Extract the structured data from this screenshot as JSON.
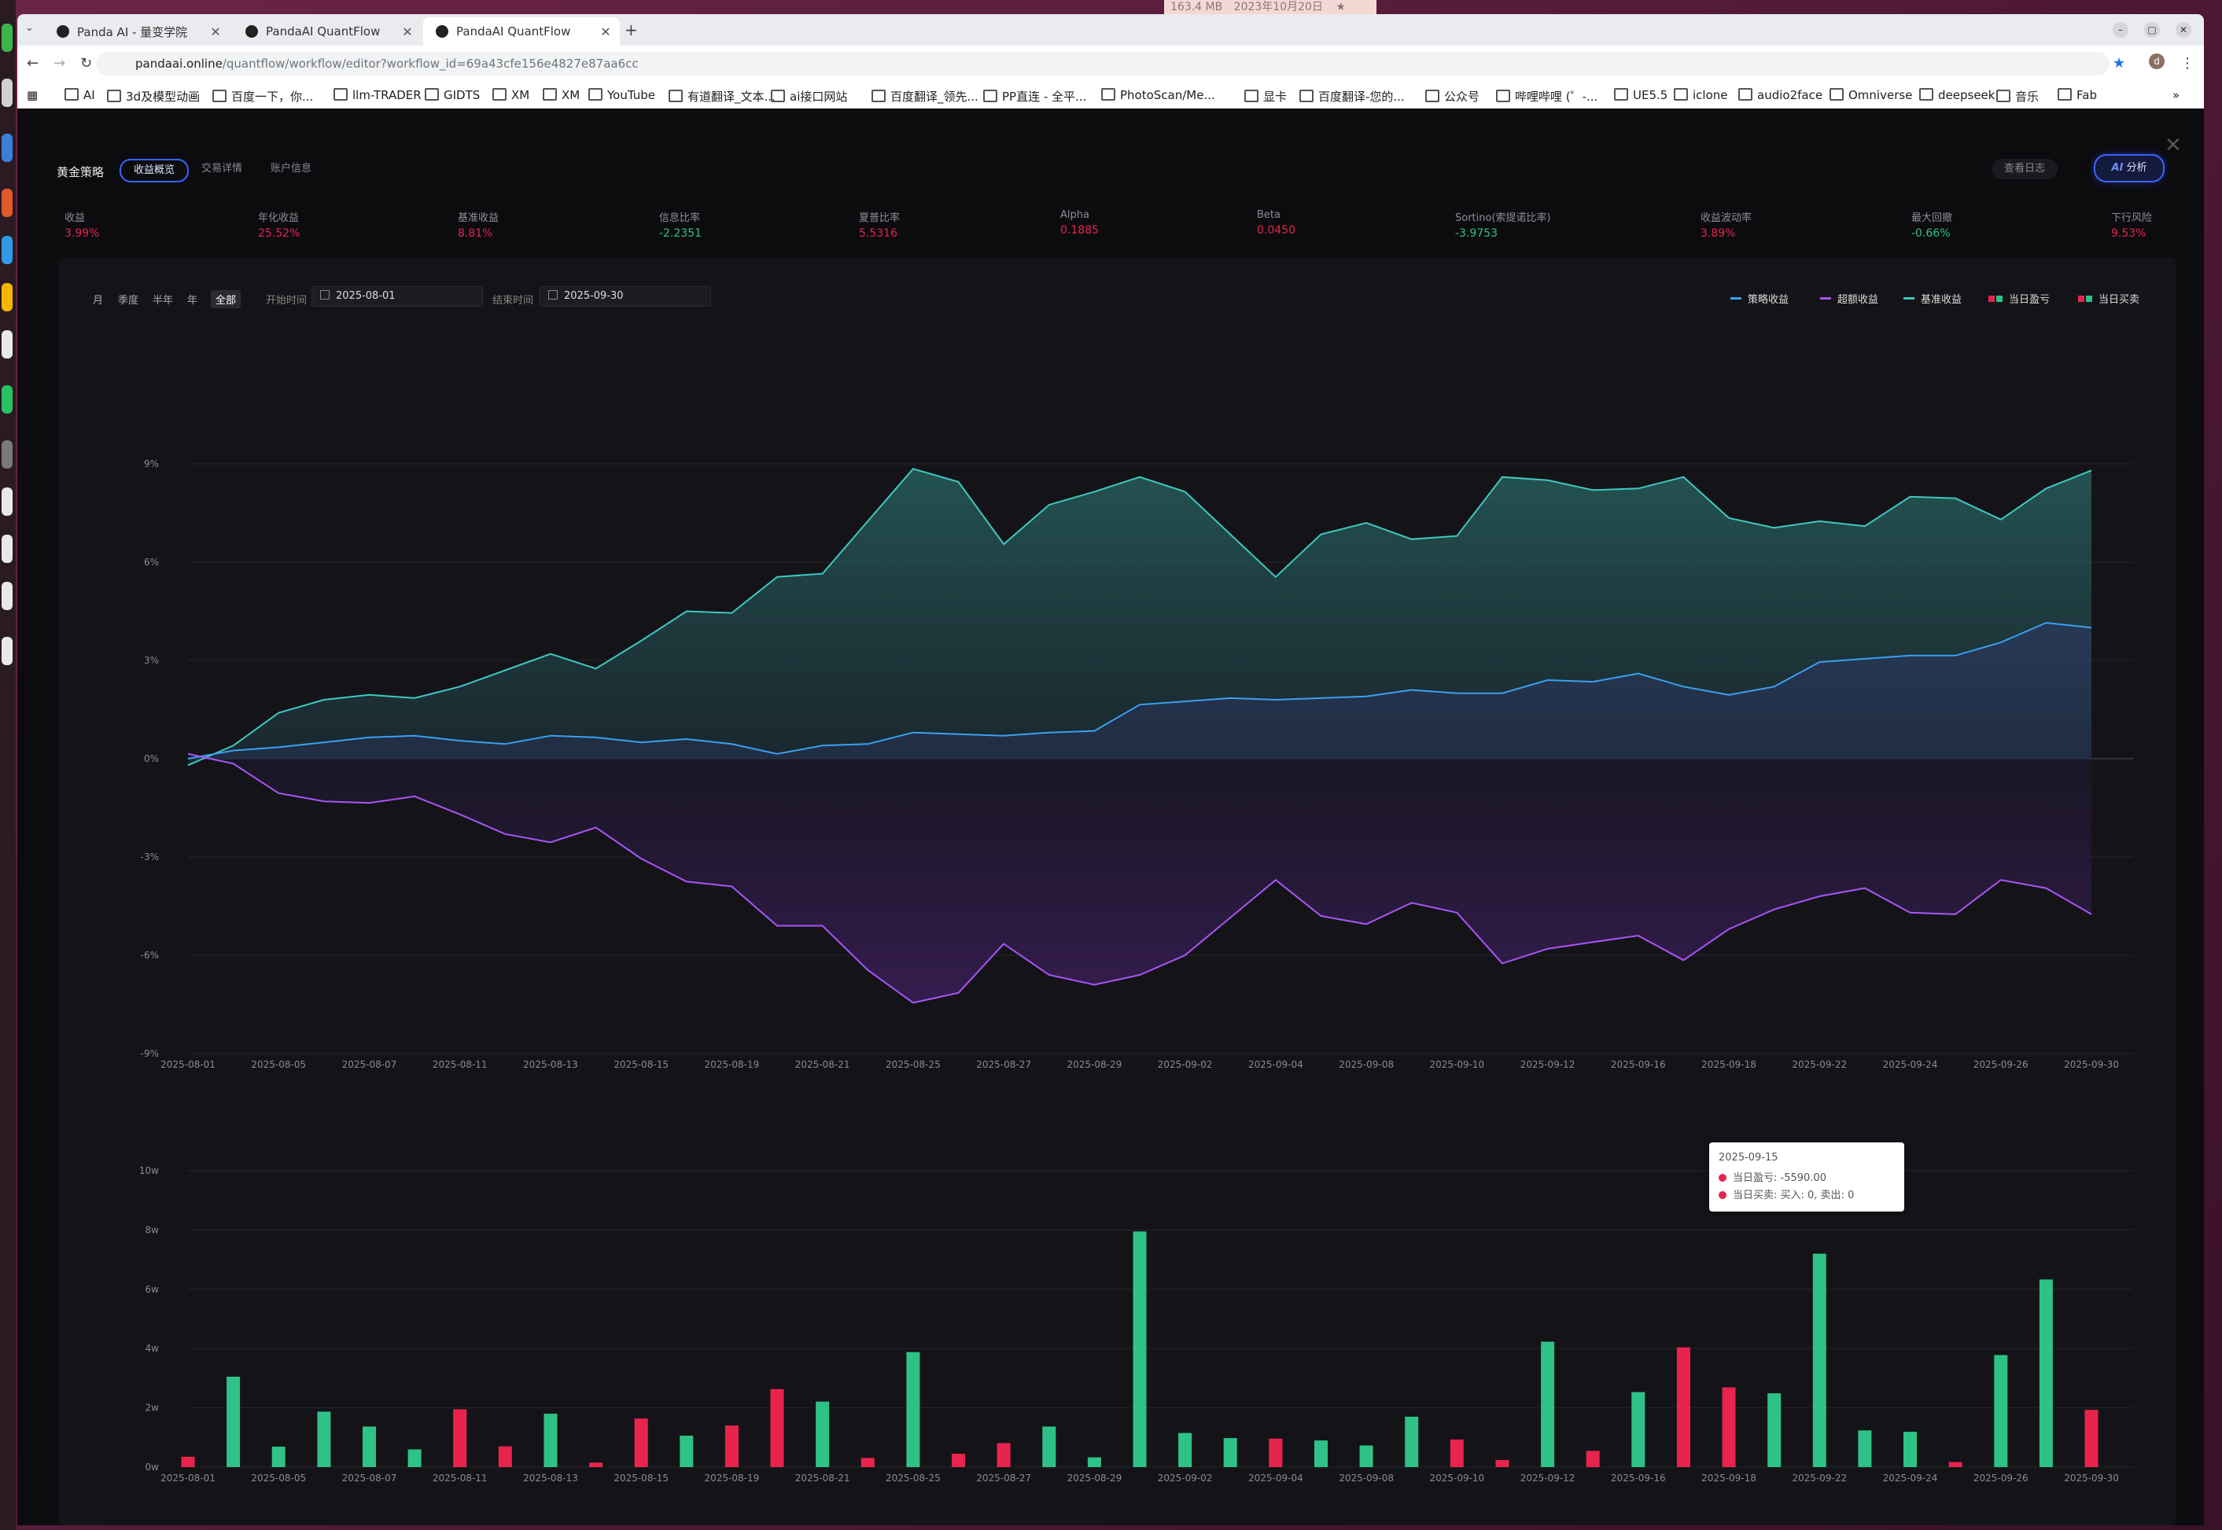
{
  "system": {
    "memory": "163.4 MB",
    "date": "2023年10月20日"
  },
  "tabs": [
    {
      "title": "Panda AI - 量变学院",
      "active": false
    },
    {
      "title": "PandaAI QuantFlow",
      "active": false
    },
    {
      "title": "PandaAI QuantFlow",
      "active": true
    }
  ],
  "address": {
    "domain": "pandaai.online",
    "path": "/quantflow/workflow/editor?workflow_id=69a43cfe156e4827e87aa6cc"
  },
  "bookmarks": [
    "AI",
    "3d及模型动画",
    "百度一下，你...",
    "llm-TRADER",
    "GIDTS",
    "XM",
    "XM",
    "YouTube",
    "有道翻译_文本...",
    "ai接口网站",
    "百度翻译_领先...",
    "PP直连 - 全平...",
    "PhotoScan/Me...",
    "显卡",
    "百度翻译-您的...",
    "公众号",
    "哔哩哔哩 (゜-...",
    "UE5.5",
    "iclone",
    "audio2face",
    "Omniverse",
    "deepseek",
    "音乐",
    "Fab"
  ],
  "header": {
    "title": "黄金策略",
    "subtabs": [
      "收益概览",
      "交易详情",
      "账户信息"
    ],
    "log_button": "查看日志",
    "ai_button": "分析",
    "ai_prefix": "AI"
  },
  "metrics": [
    {
      "label": "收益",
      "value": "3.99%",
      "color": "red"
    },
    {
      "label": "年化收益",
      "value": "25.52%",
      "color": "red"
    },
    {
      "label": "基准收益",
      "value": "8.81%",
      "color": "red"
    },
    {
      "label": "信息比率",
      "value": "-2.2351",
      "color": "green"
    },
    {
      "label": "夏普比率",
      "value": "5.5316",
      "color": "red"
    },
    {
      "label": "Alpha",
      "value": "0.1885",
      "color": "red"
    },
    {
      "label": "Beta",
      "value": "0.0450",
      "color": "red"
    },
    {
      "label": "Sortino(索提诺比率)",
      "value": "-3.9753",
      "color": "green"
    },
    {
      "label": "收益波动率",
      "value": "3.89%",
      "color": "red"
    },
    {
      "label": "最大回撤",
      "value": "-0.66%",
      "color": "green"
    },
    {
      "label": "下行风险",
      "value": "9.53%",
      "color": "red"
    }
  ],
  "controls": {
    "ranges": [
      "月",
      "季度",
      "半年",
      "年",
      "全部"
    ],
    "active_range": "全部",
    "start_label": "开始时间",
    "start_value": "2025-08-01",
    "end_label": "结束时间",
    "end_value": "2025-09-30"
  },
  "legend": [
    {
      "name": "策略收益",
      "color": "#3aa0f0",
      "kind": "line"
    },
    {
      "name": "超额收益",
      "color": "#a855f7",
      "kind": "line"
    },
    {
      "name": "基准收益",
      "color": "#3ec9c0",
      "kind": "line"
    },
    {
      "name": "当日盈亏",
      "color": "#e8244d",
      "color2": "#2fc287",
      "kind": "bar"
    },
    {
      "name": "当日买卖",
      "color": "#e8244d",
      "color2": "#2fc287",
      "kind": "bar"
    }
  ],
  "colors": {
    "strategy": "#3aa0f0",
    "excess": "#a855f7",
    "benchmark": "#3ec9c0",
    "gain": "#2fc287",
    "loss": "#e8244d"
  },
  "chart_data": [
    {
      "type": "line",
      "title": "",
      "xlabel": "",
      "ylabel": "",
      "ylim": [
        -9,
        9
      ],
      "yticks": [
        "9%",
        "6%",
        "3%",
        "0%",
        "-3%",
        "-6%",
        "-9%"
      ],
      "xticks": [
        "2025-08-01",
        "2025-08-05",
        "2025-08-07",
        "2025-08-11",
        "2025-08-13",
        "2025-08-15",
        "2025-08-19",
        "2025-08-21",
        "2025-08-25",
        "2025-08-27",
        "2025-08-29",
        "2025-09-02",
        "2025-09-04",
        "2025-09-08",
        "2025-09-10",
        "2025-09-12",
        "2025-09-16",
        "2025-09-18",
        "2025-09-22",
        "2025-09-24",
        "2025-09-26",
        "2025-09-30"
      ],
      "grid": true,
      "series": [
        {
          "name": "基准收益",
          "values": [
            -0.2,
            0.4,
            1.4,
            1.8,
            1.95,
            1.85,
            2.2,
            2.7,
            3.2,
            2.75,
            3.6,
            4.5,
            4.45,
            5.55,
            5.65,
            7.25,
            8.85,
            8.45,
            6.55,
            7.75,
            8.15,
            8.6,
            8.15,
            6.85,
            5.55,
            6.85,
            7.2,
            6.7,
            6.8,
            8.6,
            8.5,
            8.2,
            8.25,
            8.6,
            7.35,
            7.05,
            7.25,
            7.1,
            8.0,
            7.95,
            7.3,
            8.25,
            8.8
          ]
        },
        {
          "name": "策略收益",
          "values": [
            0.0,
            0.25,
            0.35,
            0.5,
            0.65,
            0.7,
            0.55,
            0.45,
            0.7,
            0.65,
            0.5,
            0.6,
            0.45,
            0.15,
            0.4,
            0.45,
            0.8,
            0.75,
            0.7,
            0.8,
            0.85,
            1.65,
            1.75,
            1.85,
            1.8,
            1.85,
            1.9,
            2.1,
            2.0,
            2.0,
            2.4,
            2.35,
            2.6,
            2.2,
            1.95,
            2.2,
            2.95,
            3.05,
            3.15,
            3.15,
            3.55,
            4.15,
            4.0
          ]
        },
        {
          "name": "超额收益",
          "values": [
            0.15,
            -0.15,
            -1.05,
            -1.3,
            -1.35,
            -1.15,
            -1.7,
            -2.3,
            -2.55,
            -2.1,
            -3.05,
            -3.75,
            -3.9,
            -5.1,
            -5.1,
            -6.45,
            -7.45,
            -7.15,
            -5.65,
            -6.6,
            -6.9,
            -6.6,
            -6.0,
            -4.85,
            -3.7,
            -4.8,
            -5.05,
            -4.4,
            -4.7,
            -6.25,
            -5.8,
            -5.6,
            -5.4,
            -6.15,
            -5.2,
            -4.6,
            -4.2,
            -3.95,
            -4.7,
            -4.75,
            -3.7,
            -3.95,
            -4.75
          ]
        }
      ]
    },
    {
      "type": "bar",
      "title": "",
      "xlabel": "",
      "ylabel": "",
      "ylim": [
        0,
        100000
      ],
      "yticks": [
        "10w",
        "8w",
        "6w",
        "4w",
        "2w",
        "0w"
      ],
      "xticks": [
        "2025-08-01",
        "2025-08-05",
        "2025-08-07",
        "2025-08-11",
        "2025-08-13",
        "2025-08-15",
        "2025-08-19",
        "2025-08-21",
        "2025-08-25",
        "2025-08-27",
        "2025-08-29",
        "2025-09-02",
        "2025-09-04",
        "2025-09-08",
        "2025-09-10",
        "2025-09-12",
        "2025-09-16",
        "2025-09-18",
        "2025-09-22",
        "2025-09-24",
        "2025-09-26",
        "2025-09-30"
      ],
      "grid": true,
      "series": [
        {
          "name": "当日盈亏",
          "values": [
            3500,
            30500,
            6900,
            18700,
            13700,
            6000,
            19500,
            7000,
            18000,
            1500,
            16400,
            10600,
            14000,
            26300,
            22100,
            3100,
            38800,
            4500,
            8100,
            13700,
            3300,
            79500,
            11500,
            9800,
            9600,
            9000,
            7300,
            17000,
            9300,
            2400,
            42300,
            5500,
            25300,
            40400,
            26900,
            24900,
            72000,
            12400,
            11900,
            1700,
            37800,
            63300,
            19300
          ],
          "signs": [
            -1,
            1,
            1,
            1,
            1,
            1,
            -1,
            -1,
            1,
            -1,
            -1,
            1,
            -1,
            -1,
            1,
            -1,
            1,
            -1,
            -1,
            1,
            1,
            1,
            1,
            1,
            -1,
            1,
            1,
            1,
            -1,
            -1,
            1,
            -1,
            1,
            -1,
            -1,
            1,
            1,
            1,
            1,
            -1,
            1,
            1,
            -1
          ]
        }
      ]
    }
  ],
  "tooltip": {
    "date": "2025-09-15",
    "rows": [
      "当日盈亏: -5590.00",
      "当日买卖: 买入: 0, 卖出: 0"
    ]
  }
}
